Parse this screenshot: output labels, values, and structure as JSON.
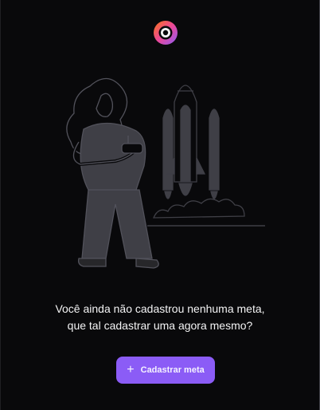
{
  "logo": {
    "icon": "app-logo-icon",
    "colors": [
      "#ec4899",
      "#f97316",
      "#8b5cf6"
    ]
  },
  "illustration": {
    "icon": "woman-rocket-launch-illustration"
  },
  "empty_state": {
    "line1": "Você ainda não cadastrou nenhuma meta,",
    "line2": "que tal cadastrar uma agora mesmo?"
  },
  "cta": {
    "icon": "plus-icon",
    "plus_glyph": "+",
    "label": "Cadastrar meta",
    "color": "#8b5cf6"
  }
}
